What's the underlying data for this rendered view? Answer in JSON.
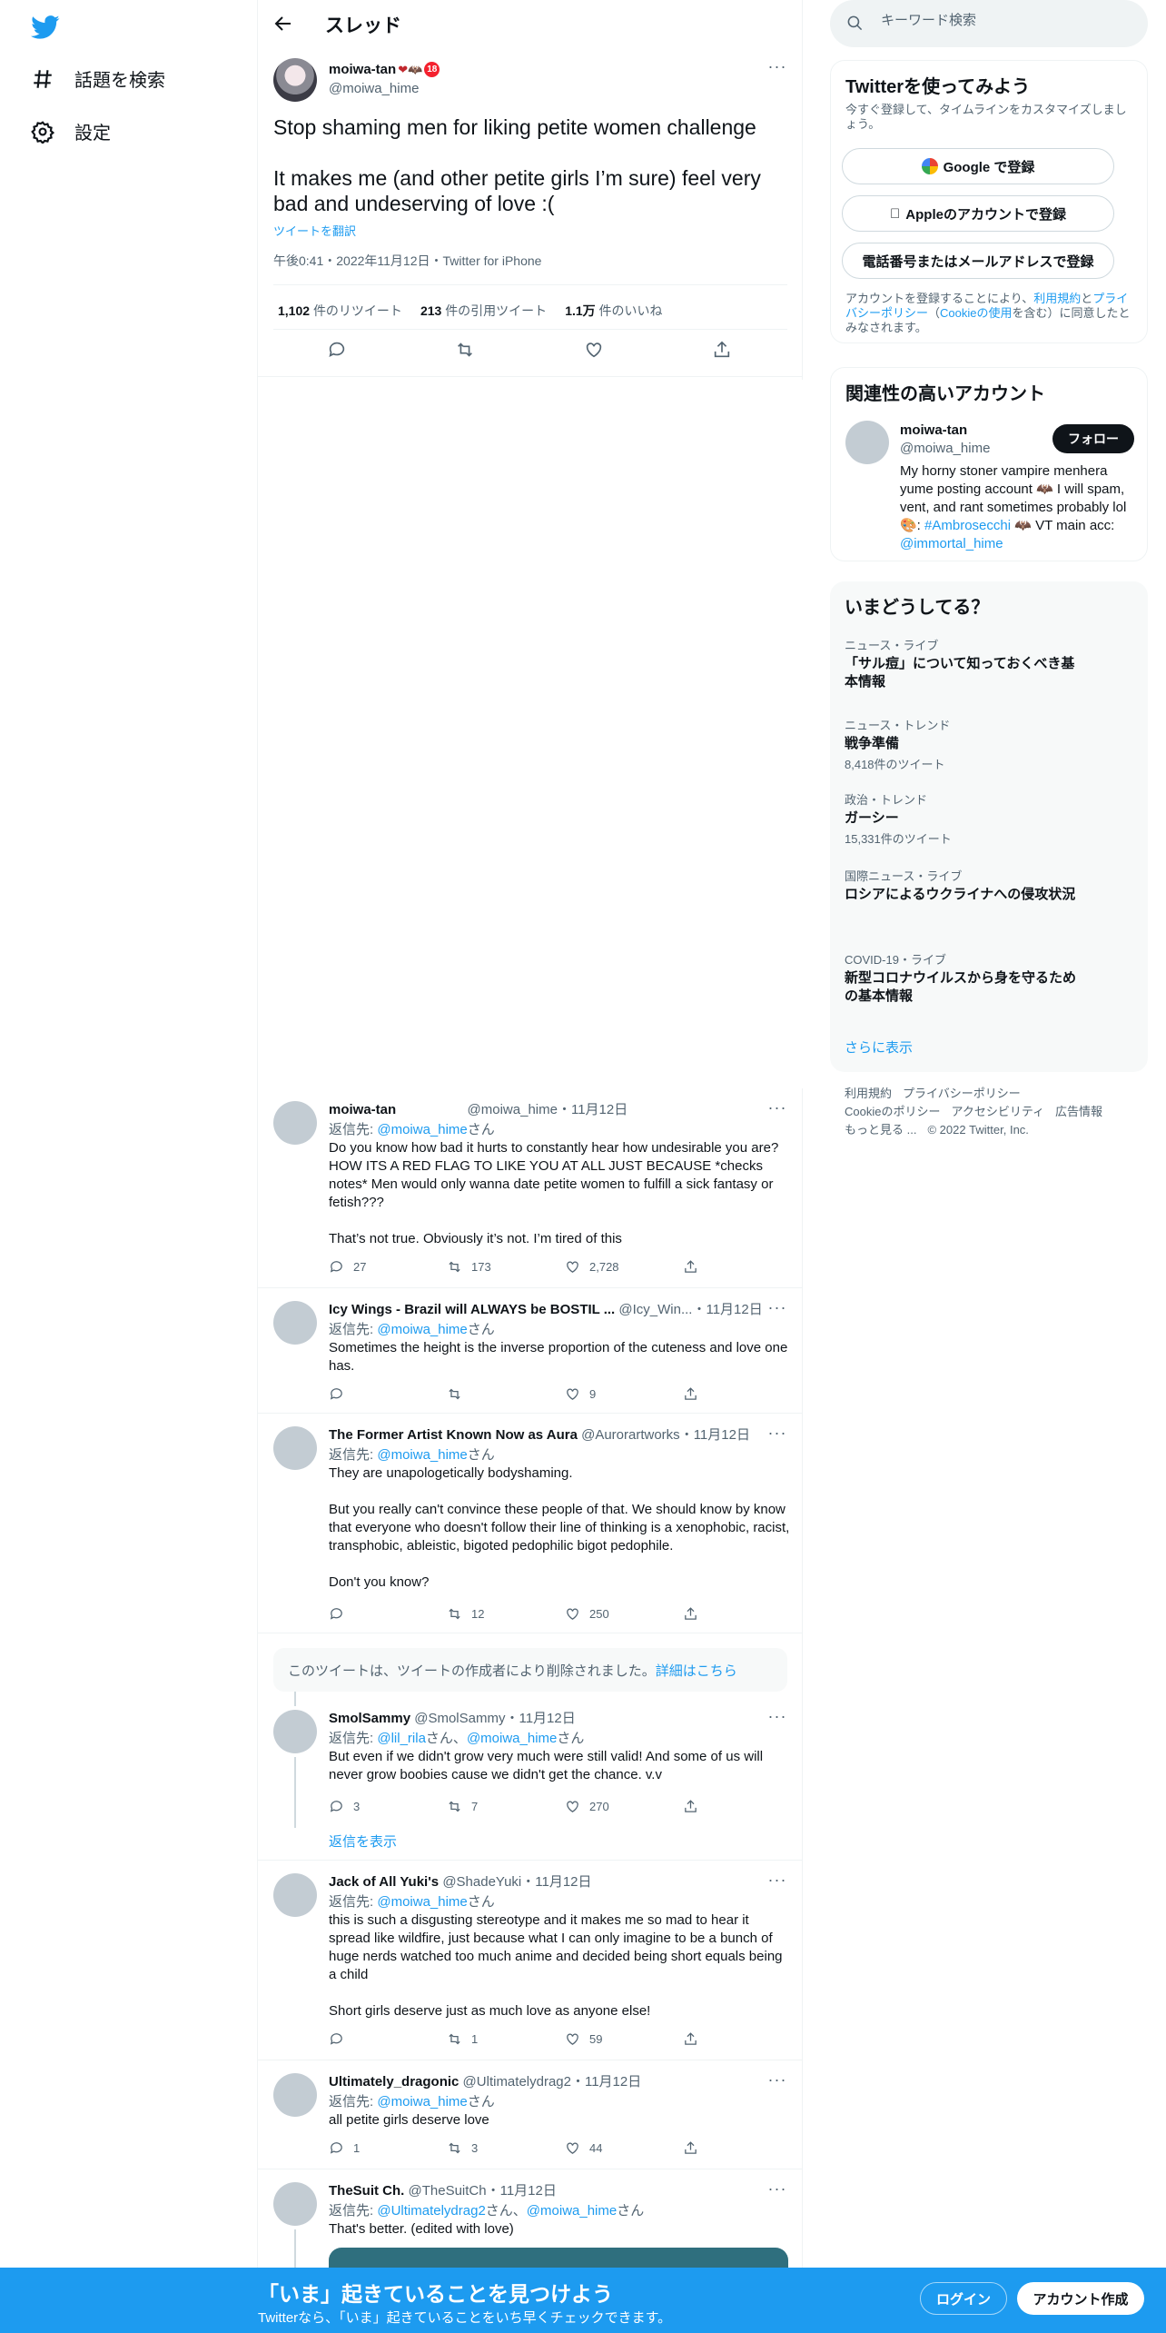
{
  "nav": {
    "explore_label": "話題を検索",
    "settings_label": "設定"
  },
  "header": {
    "title": "スレッド"
  },
  "main_tweet": {
    "name": "moiwa-tan",
    "name_emoji": "❤🦇",
    "badge": "18",
    "handle": "@moiwa_hime",
    "text": "Stop shaming men for liking petite women challenge\n\nIt makes me (and other petite girls I’m sure) feel very bad and undeserving of love :(",
    "translate": "ツイートを翻訳",
    "meta": "午後0:41・2022年11月12日・Twitter for iPhone",
    "retweets_count": "1,102",
    "retweets_label": "件のリツイート",
    "quotes_count": "213",
    "quotes_label": "件の引用ツイート",
    "likes_count": "1.1万",
    "likes_label": "件のいいね"
  },
  "replies": [
    {
      "name": "moiwa-tan",
      "handle": "@moiwa_hime",
      "date": "・11月12日",
      "reply_to_prefix": "返信先: ",
      "reply_to": "@moiwa_hime",
      "reply_to_suffix": "さん",
      "text": "Do you know how bad it hurts to constantly hear how undesirable you are? HOW ITS A RED FLAG TO LIKE YOU AT ALL JUST BECAUSE *checks notes* Men would only wanna date petite women to fulfill a sick fantasy or fetish???\n\nThat’s not true. Obviously it’s not. I’m tired of this",
      "replies": "27",
      "retweets": "173",
      "likes": "2,728"
    },
    {
      "name": "Icy Wings - Brazil will ALWAYS be BOSTIL ...",
      "handle": "@Icy_Win...",
      "date": "・11月12日",
      "reply_to_prefix": "返信先: ",
      "reply_to": "@moiwa_hime",
      "reply_to_suffix": "さん",
      "text": "Sometimes the height is the inverse proportion of the cuteness and love one has.",
      "replies": "",
      "retweets": "",
      "likes": "9"
    },
    {
      "name": "The Former Artist Known Now as Aura",
      "handle": "@Aurorartworks",
      "date": "・11月12日",
      "reply_to_prefix": "返信先: ",
      "reply_to": "@moiwa_hime",
      "reply_to_suffix": "さん",
      "text": "They are unapologetically bodyshaming.\n\nBut you really can't convince these people of that. We should know by know that everyone who doesn't follow their line of thinking is a xenophobic, racist, transphobic, ableistic, bigoted pedophilic bigot pedophile.\n\nDon't you know?",
      "replies": "",
      "retweets": "12",
      "likes": "250"
    },
    {
      "name": "SmolSammy",
      "handle": "@SmolSammy",
      "date": "・11月12日",
      "reply_to_prefix": "返信先: ",
      "reply_to": "@lil_rila",
      "reply_to_mid": "さん、",
      "reply_to_2": "@moiwa_hime",
      "reply_to_suffix": "さん",
      "text": "But even if we didn't grow very much were still valid! And some of us will never grow boobies cause we didn't get the chance.  v.v",
      "replies": "3",
      "retweets": "7",
      "likes": "270"
    },
    {
      "name": "Jack of All Yuki's",
      "handle": "@ShadeYuki",
      "date": "・11月12日",
      "reply_to_prefix": "返信先: ",
      "reply_to": "@moiwa_hime",
      "reply_to_suffix": "さん",
      "text": "this is such a disgusting stereotype and it makes me so mad to hear it spread like wildfire, just because what I can only imagine to be a bunch of huge nerds watched too much anime and decided being short equals being a child\n\nShort girls deserve just as much love as anyone else!",
      "replies": "",
      "retweets": "1",
      "likes": "59"
    },
    {
      "name": "Ultimately_dragonic",
      "handle": "@Ultimatelydrag2",
      "date": "・11月12日",
      "reply_to_prefix": "返信先: ",
      "reply_to": "@moiwa_hime",
      "reply_to_suffix": "さん",
      "text": "all petite girls deserve love",
      "replies": "1",
      "retweets": "3",
      "likes": "44"
    },
    {
      "name": "TheSuit Ch.",
      "handle": "@TheSuitCh",
      "date": "・11月12日",
      "reply_to_prefix": "返信先: ",
      "reply_to": "@Ultimatelydrag2",
      "reply_to_mid": "さん、",
      "reply_to_2": "@moiwa_hime",
      "reply_to_suffix": "さん",
      "text": "That's better. (edited with love)"
    }
  ],
  "deleted_notice": {
    "text": "このツイートは、ツイートの作成者により削除されました。",
    "link": "詳細はこちら"
  },
  "show_replies": "返信を表示",
  "search": {
    "placeholder": "キーワード検索"
  },
  "signup_card": {
    "title": "Twitterを使ってみよう",
    "subtitle": "今すぐ登録して、タイムラインをカスタマイズしましょう。",
    "google_label": "Google で登録",
    "apple_label": "Appleのアカウントで登録",
    "phone_label": "電話番号またはメールアドレスで登録",
    "legal_1": "アカウントを登録することにより、",
    "legal_terms": "利用規約",
    "legal_2": "と",
    "legal_privacy": "プライバシーポリシー",
    "legal_3": "（",
    "legal_cookie": "Cookieの使用",
    "legal_4": "を含む）に同意したとみなされます。"
  },
  "related": {
    "title": "関連性の高いアカウント",
    "name": "moiwa-tan",
    "handle": "@moiwa_hime",
    "follow": "フォロー",
    "bio_1": "My horny stoner vampire menhera yume posting account 🦇 I will spam, vent, and rant sometimes probably lol 🎨: ",
    "bio_tag": "#Ambrosecchi",
    "bio_2": " 🦇 VT main acc: ",
    "bio_link": "@immortal_hime"
  },
  "trends": {
    "title": "いまどうしてる？",
    "items": [
      {
        "category": "ニュース・ライブ",
        "name": "「サル痘」について知っておくべき基本情報",
        "count": ""
      },
      {
        "category": "ニュース・トレンド",
        "name": "戦争準備",
        "count": "8,418件のツイート"
      },
      {
        "category": "政治・トレンド",
        "name": "ガーシー",
        "count": "15,331件のツイート"
      },
      {
        "category": "国際ニュース・ライブ",
        "name": "ロシアによるウクライナへの侵攻状況",
        "count": ""
      },
      {
        "category": "COVID-19・ライブ",
        "name": "新型コロナウイルスから身を守るための基本情報",
        "count": ""
      }
    ],
    "show_more": "さらに表示"
  },
  "footer": {
    "terms": "利用規約",
    "privacy": "プライバシーポリシー",
    "cookie": "Cookieのポリシー",
    "accessibility": "アクセシビリティ",
    "ads": "広告情報",
    "more": "もっと見る ...",
    "copyright": "© 2022 Twitter, Inc."
  },
  "bottom_bar": {
    "title": "「いま」起きていることを見つけよう",
    "subtitle": "Twitterなら、「いま」起きていることをいち早くチェックできます。",
    "login": "ログイン",
    "signup": "アカウント作成"
  },
  "colors": {
    "accent": "#1d9bf0",
    "text": "#0f1419",
    "muted": "#536471"
  }
}
